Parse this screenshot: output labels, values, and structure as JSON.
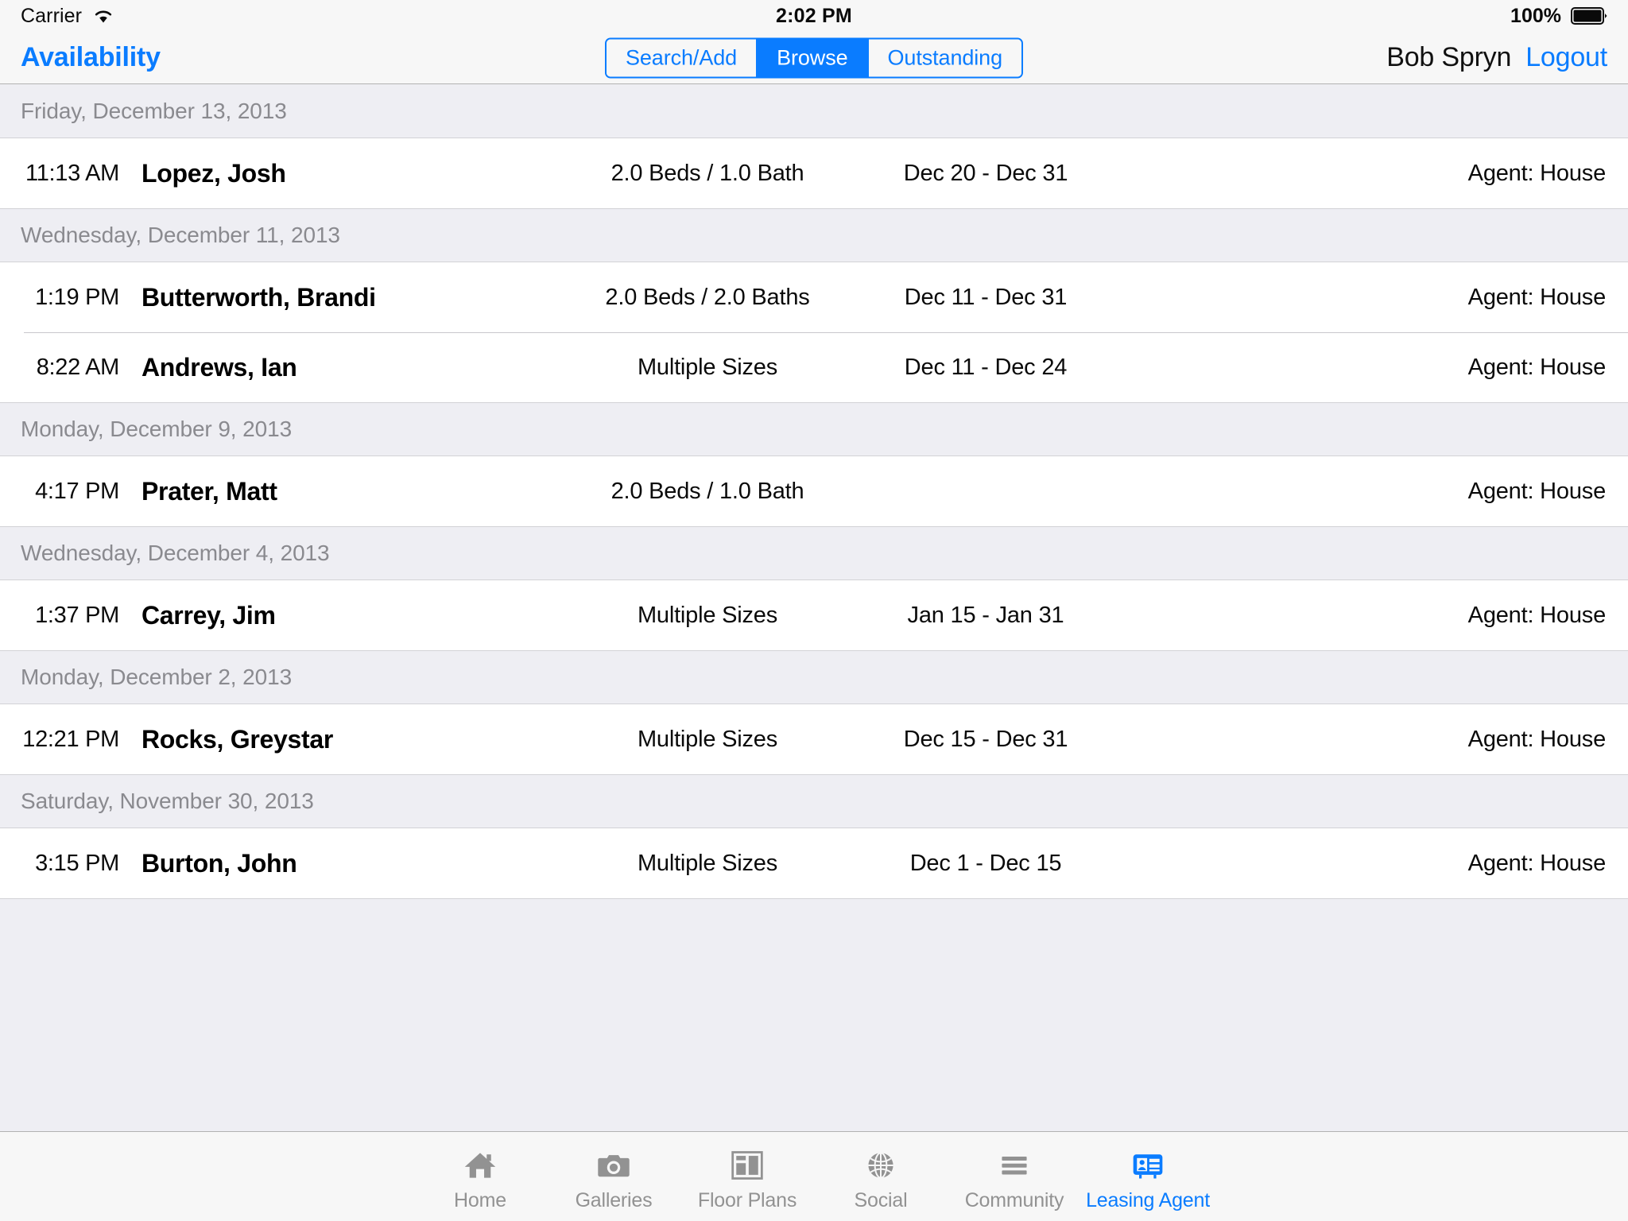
{
  "colors": {
    "accent": "#0a7cff",
    "bar_background": "#f7f7f7",
    "section_background": "#eeeef3",
    "row_background": "#ffffff",
    "separator": "#c8c7cc",
    "muted_text": "#8a8a8f",
    "tab_inactive": "#929292"
  },
  "status_bar": {
    "carrier": "Carrier",
    "wifi_icon": "wifi-icon",
    "time": "2:02 PM",
    "battery_percent": "100%",
    "battery_icon": "battery-full-icon"
  },
  "nav_bar": {
    "title": "Availability",
    "segments": [
      {
        "label": "Search/Add",
        "active": false
      },
      {
        "label": "Browse",
        "active": true
      },
      {
        "label": "Outstanding",
        "active": false
      }
    ],
    "user_name": "Bob Spryn",
    "logout_label": "Logout"
  },
  "list": {
    "sections": [
      {
        "title": "Friday, December 13, 2013",
        "rows": [
          {
            "time": "11:13 AM",
            "name": "Lopez, Josh",
            "size": "2.0 Beds / 1.0 Bath",
            "dates": "Dec 20 - Dec 31",
            "agent": "Agent: House"
          }
        ]
      },
      {
        "title": "Wednesday, December 11, 2013",
        "rows": [
          {
            "time": "1:19 PM",
            "name": "Butterworth, Brandi",
            "size": "2.0 Beds / 2.0 Baths",
            "dates": "Dec 11 - Dec 31",
            "agent": "Agent: House"
          },
          {
            "time": "8:22 AM",
            "name": "Andrews, Ian",
            "size": "Multiple Sizes",
            "dates": "Dec 11 - Dec 24",
            "agent": "Agent: House"
          }
        ]
      },
      {
        "title": "Monday, December 9, 2013",
        "rows": [
          {
            "time": "4:17 PM",
            "name": "Prater, Matt",
            "size": "2.0 Beds / 1.0 Bath",
            "dates": "",
            "agent": "Agent: House"
          }
        ]
      },
      {
        "title": "Wednesday, December 4, 2013",
        "rows": [
          {
            "time": "1:37 PM",
            "name": "Carrey, Jim",
            "size": "Multiple Sizes",
            "dates": "Jan 15 - Jan 31",
            "agent": "Agent: House"
          }
        ]
      },
      {
        "title": "Monday, December 2, 2013",
        "rows": [
          {
            "time": "12:21 PM",
            "name": "Rocks, Greystar",
            "size": "Multiple Sizes",
            "dates": "Dec 15 - Dec 31",
            "agent": "Agent: House"
          }
        ]
      },
      {
        "title": "Saturday, November 30, 2013",
        "rows": [
          {
            "time": "3:15 PM",
            "name": "Burton, John",
            "size": "Multiple Sizes",
            "dates": "Dec 1 - Dec 15",
            "agent": "Agent: House"
          }
        ]
      }
    ]
  },
  "tab_bar": {
    "items": [
      {
        "label": "Home",
        "icon": "home-icon",
        "active": false
      },
      {
        "label": "Galleries",
        "icon": "camera-icon",
        "active": false
      },
      {
        "label": "Floor Plans",
        "icon": "floor-plan-icon",
        "active": false
      },
      {
        "label": "Social",
        "icon": "globe-icon",
        "active": false
      },
      {
        "label": "Community",
        "icon": "list-lines-icon",
        "active": false
      },
      {
        "label": "Leasing Agent",
        "icon": "id-badge-icon",
        "active": true
      }
    ]
  }
}
